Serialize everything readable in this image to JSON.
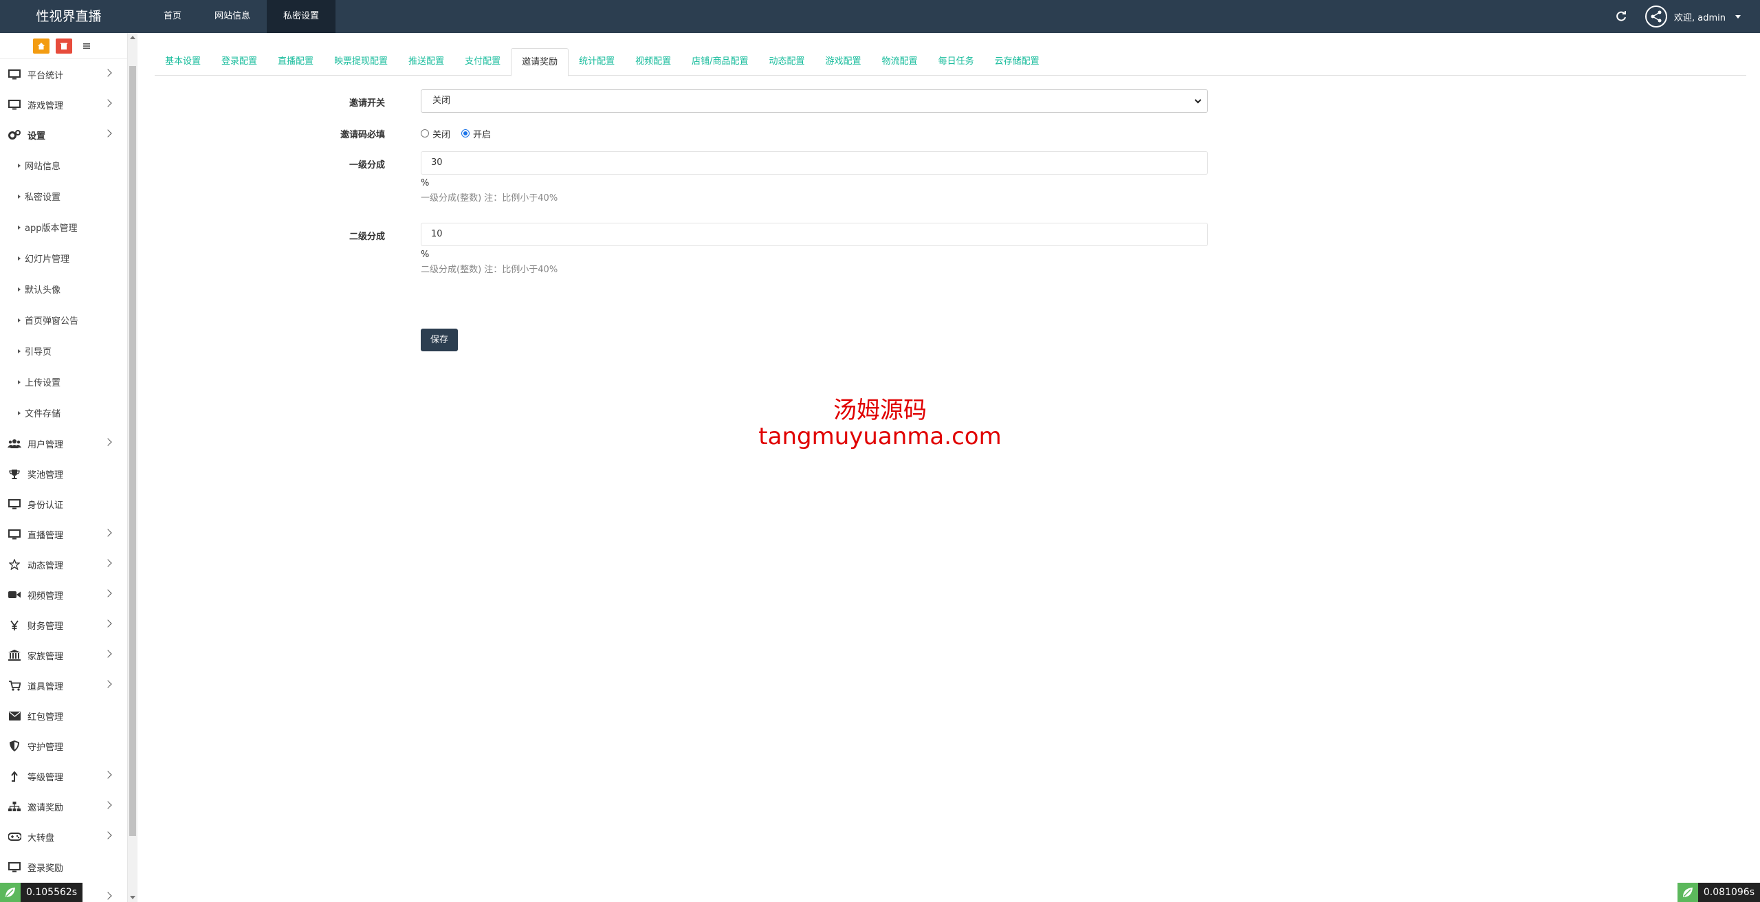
{
  "app": {
    "brand": "性视界直播"
  },
  "topnav": [
    {
      "label": "首页",
      "active": false
    },
    {
      "label": "网站信息",
      "active": false
    },
    {
      "label": "私密设置",
      "active": true
    }
  ],
  "user": {
    "welcome": "欢迎, admin"
  },
  "sidebar": {
    "items": [
      {
        "label": "平台统计",
        "icon": "monitor-icon",
        "expand": true
      },
      {
        "label": "游戏管理",
        "icon": "monitor-icon",
        "expand": true
      },
      {
        "label": "设置",
        "icon": "gears-icon",
        "expand": true
      },
      {
        "label": "用户管理",
        "icon": "users-icon",
        "expand": true
      },
      {
        "label": "奖池管理",
        "icon": "trophy-icon",
        "expand": false
      },
      {
        "label": "身份认证",
        "icon": "monitor-icon",
        "expand": false
      },
      {
        "label": "直播管理",
        "icon": "monitor-icon",
        "expand": true
      },
      {
        "label": "动态管理",
        "icon": "star-icon",
        "expand": true
      },
      {
        "label": "视频管理",
        "icon": "video-camera-icon",
        "expand": true
      },
      {
        "label": "财务管理",
        "icon": "yen-icon",
        "expand": true
      },
      {
        "label": "家族管理",
        "icon": "bank-icon",
        "expand": true
      },
      {
        "label": "道具管理",
        "icon": "cart-icon",
        "expand": true
      },
      {
        "label": "红包管理",
        "icon": "envelope-icon",
        "expand": false
      },
      {
        "label": "守护管理",
        "icon": "shield-icon",
        "expand": false
      },
      {
        "label": "等级管理",
        "icon": "level-arrow-icon",
        "expand": true
      },
      {
        "label": "邀请奖励",
        "icon": "sitemap-icon",
        "expand": true
      },
      {
        "label": "大转盘",
        "icon": "gamepad-icon",
        "expand": true
      },
      {
        "label": "登录奖励",
        "icon": "monitor-icon",
        "expand": false
      }
    ],
    "sub_items": [
      "网站信息",
      "私密设置",
      "app版本管理",
      "幻灯片管理",
      "默认头像",
      "首页弹窗公告",
      "引导页",
      "上传设置",
      "文件存储"
    ]
  },
  "tabs": [
    {
      "label": "基本设置",
      "active": false
    },
    {
      "label": "登录配置",
      "active": false
    },
    {
      "label": "直播配置",
      "active": false
    },
    {
      "label": "映票提现配置",
      "active": false
    },
    {
      "label": "推送配置",
      "active": false
    },
    {
      "label": "支付配置",
      "active": false
    },
    {
      "label": "邀请奖励",
      "active": true
    },
    {
      "label": "统计配置",
      "active": false
    },
    {
      "label": "视频配置",
      "active": false
    },
    {
      "label": "店铺/商品配置",
      "active": false
    },
    {
      "label": "动态配置",
      "active": false
    },
    {
      "label": "游戏配置",
      "active": false
    },
    {
      "label": "物流配置",
      "active": false
    },
    {
      "label": "每日任务",
      "active": false
    },
    {
      "label": "云存储配置",
      "active": false
    }
  ],
  "form": {
    "invite_switch": {
      "label": "邀请开关",
      "value": "关闭"
    },
    "invite_code_required": {
      "label": "邀请码必填",
      "options": [
        "关闭",
        "开启"
      ],
      "selected": "开启"
    },
    "level1": {
      "label": "一级分成",
      "value": "30",
      "unit": "%",
      "help": "一级分成(整数) 注：比例小于40%"
    },
    "level2": {
      "label": "二级分成",
      "value": "10",
      "unit": "%",
      "help": "二级分成(整数) 注：比例小于40%"
    },
    "save_label": "保存"
  },
  "watermark": {
    "line1": "汤姆源码",
    "line2": "tangmuyuanma.com"
  },
  "timers": {
    "left": "0.105562s",
    "right": "0.081096s"
  },
  "colors": {
    "topbar": "#2c3e50",
    "tab_link": "#18bc9c",
    "shortcut_home": "#f39c12",
    "shortcut_trash": "#e74c3c",
    "watermark": "#e00000"
  }
}
